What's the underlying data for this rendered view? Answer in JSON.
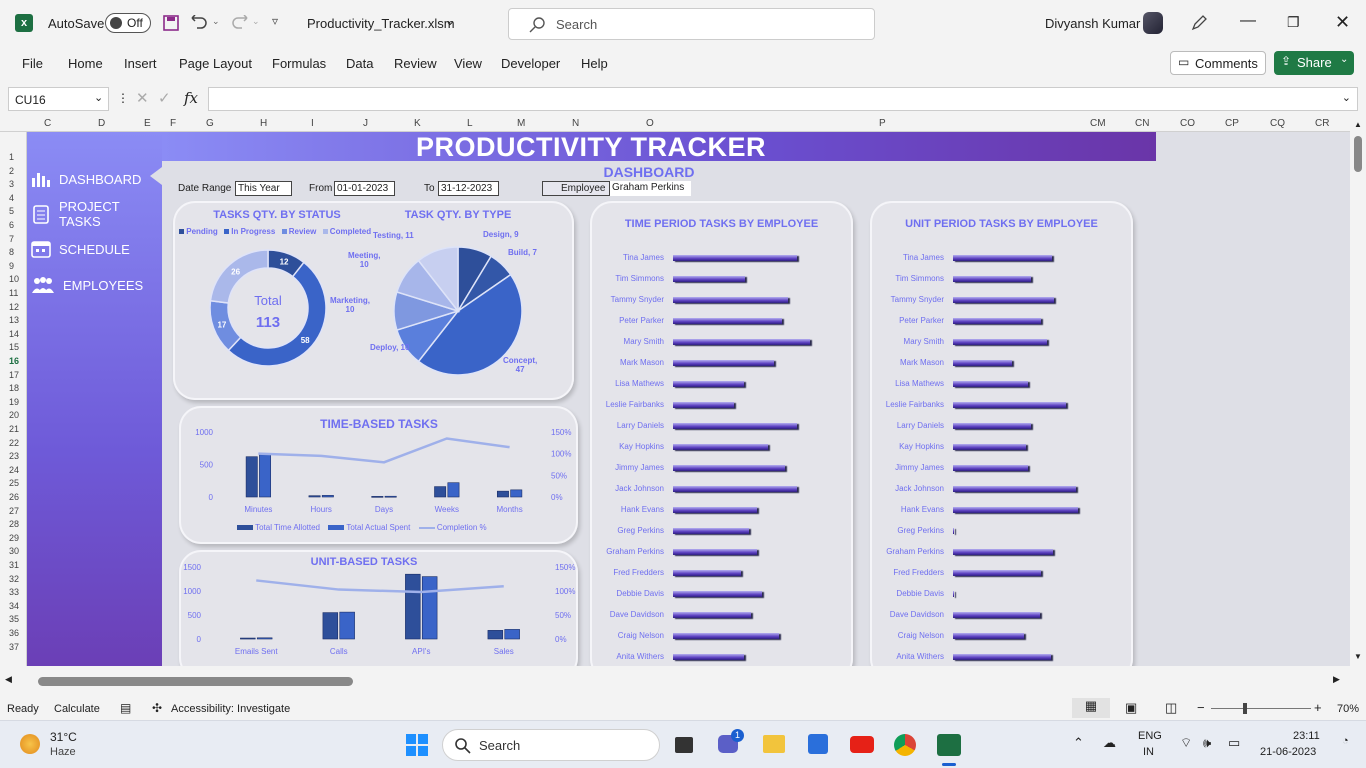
{
  "titlebar": {
    "autosave_label": "AutoSave",
    "autosave_state": "Off",
    "filename": "Productivity_Tracker.xlsm",
    "search_placeholder": "Search",
    "user": "Divyansh Kumar"
  },
  "ribbon": {
    "tabs": [
      "File",
      "Home",
      "Insert",
      "Page Layout",
      "Formulas",
      "Data",
      "Review",
      "View",
      "Developer",
      "Help"
    ],
    "comments": "Comments",
    "share": "Share"
  },
  "formula_bar": {
    "cell_ref": "CU16",
    "fx": "fx"
  },
  "columns": [
    "C",
    "D",
    "E",
    "F",
    "G",
    "H",
    "I",
    "J",
    "K",
    "L",
    "M",
    "N",
    "O",
    "P",
    "CM",
    "CN",
    "CO",
    "CP",
    "CQ",
    "CR"
  ],
  "rows": [
    "1",
    "2",
    "3",
    "4",
    "5",
    "6",
    "7",
    "8",
    "9",
    "10",
    "11",
    "12",
    "13",
    "14",
    "15",
    "16",
    "17",
    "18",
    "19",
    "20",
    "21",
    "22",
    "23",
    "24",
    "25",
    "26",
    "27",
    "28",
    "29",
    "30",
    "31",
    "32",
    "33",
    "34",
    "35",
    "36",
    "37"
  ],
  "sidebar": {
    "items": [
      {
        "label": "DASHBOARD",
        "icon": "bar-chart-icon"
      },
      {
        "label": "PROJECT TASKS",
        "icon": "clipboard-icon"
      },
      {
        "label": "SCHEDULE",
        "icon": "calendar-icon"
      },
      {
        "label": "EMPLOYEES",
        "icon": "people-icon"
      }
    ]
  },
  "banner": {
    "title": "PRODUCTIVITY TRACKER",
    "subtitle": "DASHBOARD"
  },
  "filters": {
    "date_range_label": "Date Range",
    "date_range_value": "This Year",
    "from_label": "From",
    "from_value": "01-01-2023",
    "to_label": "To",
    "to_value": "31-12-2023",
    "employee_label": "Employee",
    "employee_value": "Graham Perkins"
  },
  "status_chart": {
    "title": "TASKS QTY. BY STATUS",
    "legend": [
      "Pending",
      "In Progress",
      "Review",
      "Completed"
    ],
    "total_label": "Total",
    "total_value": "113"
  },
  "type_chart": {
    "title": "TASK QTY. BY TYPE"
  },
  "time_chart": {
    "title": "TIME-BASED TASKS",
    "legend": [
      "Total Time Allotted",
      "Total Actual Spent",
      "Completion %"
    ]
  },
  "unit_chart": {
    "title": "UNIT-BASED TASKS"
  },
  "time_period": {
    "title": "TIME PERIOD TASKS BY EMPLOYEE"
  },
  "unit_period": {
    "title": "UNIT PERIOD TASKS BY EMPLOYEE"
  },
  "chart_data": [
    {
      "type": "pie",
      "title": "TASKS QTY. BY STATUS",
      "categories": [
        "Pending",
        "In Progress",
        "Review",
        "Completed"
      ],
      "values": [
        12,
        58,
        17,
        26
      ],
      "legend": "top"
    },
    {
      "type": "pie",
      "title": "TASK QTY. BY TYPE",
      "categories": [
        "Design",
        "Build",
        "Concept",
        "Deploy",
        "Marketing",
        "Meeting",
        "Testing"
      ],
      "values": [
        9,
        7,
        47,
        10,
        10,
        10,
        11
      ]
    },
    {
      "type": "bar",
      "title": "TIME-BASED TASKS",
      "categories": [
        "Minutes",
        "Hours",
        "Days",
        "Weeks",
        "Months"
      ],
      "series": [
        {
          "name": "Total Time Allotted",
          "values": [
            620,
            20,
            10,
            160,
            90
          ]
        },
        {
          "name": "Total Actual Spent",
          "values": [
            650,
            25,
            12,
            220,
            110
          ]
        },
        {
          "name": "Completion %",
          "values": [
            1.0,
            0.95,
            0.8,
            1.35,
            1.15
          ]
        }
      ],
      "ylim": [
        0,
        1000
      ],
      "y2lim": [
        0,
        1.5
      ],
      "yticks": [
        "0",
        "500",
        "1000"
      ],
      "y2ticks": [
        "0%",
        "50%",
        "100%",
        "150%"
      ]
    },
    {
      "type": "bar",
      "title": "UNIT-BASED TASKS",
      "categories": [
        "Emails Sent",
        "Calls",
        "API's",
        "Sales"
      ],
      "series": [
        {
          "values": [
            20,
            550,
            1350,
            180
          ]
        },
        {
          "values": [
            25,
            560,
            1300,
            200
          ]
        },
        {
          "values": [
            1.22,
            1.03,
            0.98,
            1.1
          ]
        }
      ],
      "ylim": [
        0,
        1500
      ],
      "y2lim": [
        0,
        1.5
      ],
      "yticks": [
        "0",
        "500",
        "1000",
        "1500"
      ],
      "y2ticks": [
        "0%",
        "50%",
        "100%",
        "150%"
      ]
    },
    {
      "type": "bar",
      "title": "TIME PERIOD TASKS BY EMPLOYEE",
      "categories": [
        "Tina James",
        "Tim Simmons",
        "Tammy Snyder",
        "Peter Parker",
        "Mary Smith",
        "Mark Mason",
        "Lisa Mathews",
        "Leslie Fairbanks",
        "Larry Daniels",
        "Kay Hopkins",
        "Jimmy James",
        "Jack Johnson",
        "Hank Evans",
        "Greg Perkins",
        "Graham Perkins",
        "Fred Fredders",
        "Debbie Davis",
        "Dave Davidson",
        "Craig Nelson",
        "Anita Withers"
      ],
      "values": [
        115,
        67,
        107,
        101,
        127,
        94,
        66,
        57,
        115,
        88,
        104,
        115,
        78,
        71,
        78,
        63,
        83,
        72,
        98,
        66
      ],
      "xlim": [
        0,
        130
      ]
    },
    {
      "type": "bar",
      "title": "UNIT PERIOD TASKS BY EMPLOYEE",
      "categories": [
        "Tina James",
        "Tim Simmons",
        "Tammy Snyder",
        "Peter Parker",
        "Mary Smith",
        "Mark Mason",
        "Lisa Mathews",
        "Leslie Fairbanks",
        "Larry Daniels",
        "Kay Hopkins",
        "Jimmy James",
        "Jack Johnson",
        "Hank Evans",
        "Greg Perkins",
        "Graham Perkins",
        "Fred Fredders",
        "Debbie Davis",
        "Dave Davidson",
        "Craig Nelson",
        "Anita Withers"
      ],
      "values": [
        92,
        72,
        94,
        82,
        87,
        55,
        70,
        105,
        72,
        68,
        70,
        114,
        116,
        1,
        93,
        82,
        1,
        81,
        66,
        91
      ],
      "xlim": [
        0,
        130
      ]
    }
  ],
  "status": {
    "ready": "Ready",
    "calculate": "Calculate",
    "accessibility": "Accessibility: Investigate",
    "zoom": "70%"
  },
  "taskbar": {
    "temp": "31°C",
    "weather": "Haze",
    "search": "Search",
    "lang1": "ENG",
    "lang2": "IN",
    "time": "23:11",
    "date": "21-06-2023",
    "chat_badge": "1"
  }
}
